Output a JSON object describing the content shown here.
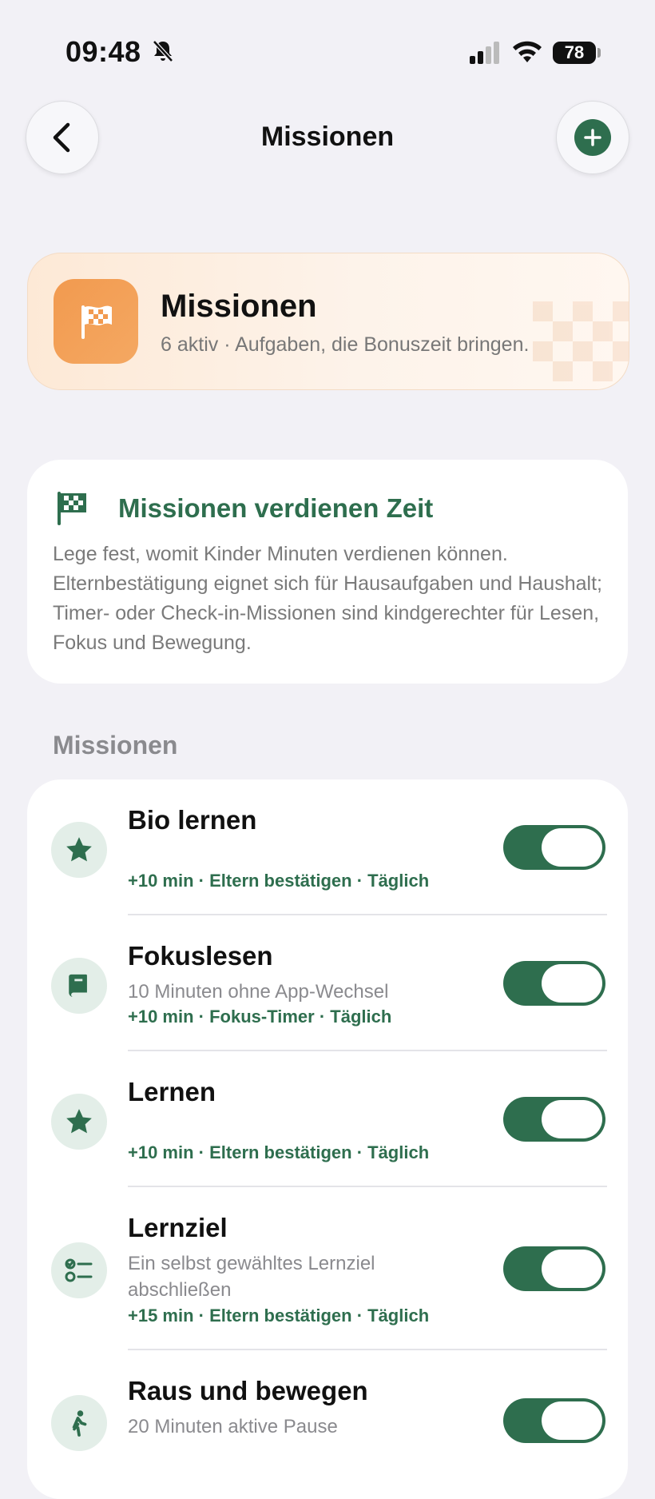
{
  "status": {
    "time": "09:48",
    "battery": "78"
  },
  "nav": {
    "title": "Missionen"
  },
  "hero": {
    "title": "Missionen",
    "subtitle": "6 aktiv · Aufgaben, die Bonuszeit bringen."
  },
  "info": {
    "title": "Missionen verdienen Zeit",
    "text": "Lege fest, womit Kinder Minuten verdienen können. Elternbestätigung eignet sich für Hausaufgaben und Haushalt; Timer- oder Check-in-Missionen sind kindgerechter für Lesen, Fokus und Bewegung."
  },
  "section": {
    "label": "Missionen"
  },
  "missions": [
    {
      "icon": "star-icon",
      "title": "Bio lernen",
      "description": "",
      "meta": "+10 min · Eltern bestätigen · Täglich",
      "enabled": true
    },
    {
      "icon": "book-icon",
      "title": "Fokuslesen",
      "description": "10 Minuten ohne App-Wechsel",
      "meta": "+10 min · Fokus-Timer · Täglich",
      "enabled": true
    },
    {
      "icon": "star-icon",
      "title": "Lernen",
      "description": "",
      "meta": "+10 min · Eltern bestätigen · Täglich",
      "enabled": true
    },
    {
      "icon": "checklist-icon",
      "title": "Lernziel",
      "description": "Ein selbst gewähltes Lernziel abschließen",
      "meta": "+15 min · Eltern bestätigen · Täglich",
      "enabled": true
    },
    {
      "icon": "walk-icon",
      "title": "Raus und bewegen",
      "description": "20 Minuten aktive Pause",
      "meta": "",
      "enabled": true
    }
  ],
  "colors": {
    "accent": "#2e6e4e",
    "hero_icon": "#f29a4f",
    "background": "#f2f1f6"
  }
}
